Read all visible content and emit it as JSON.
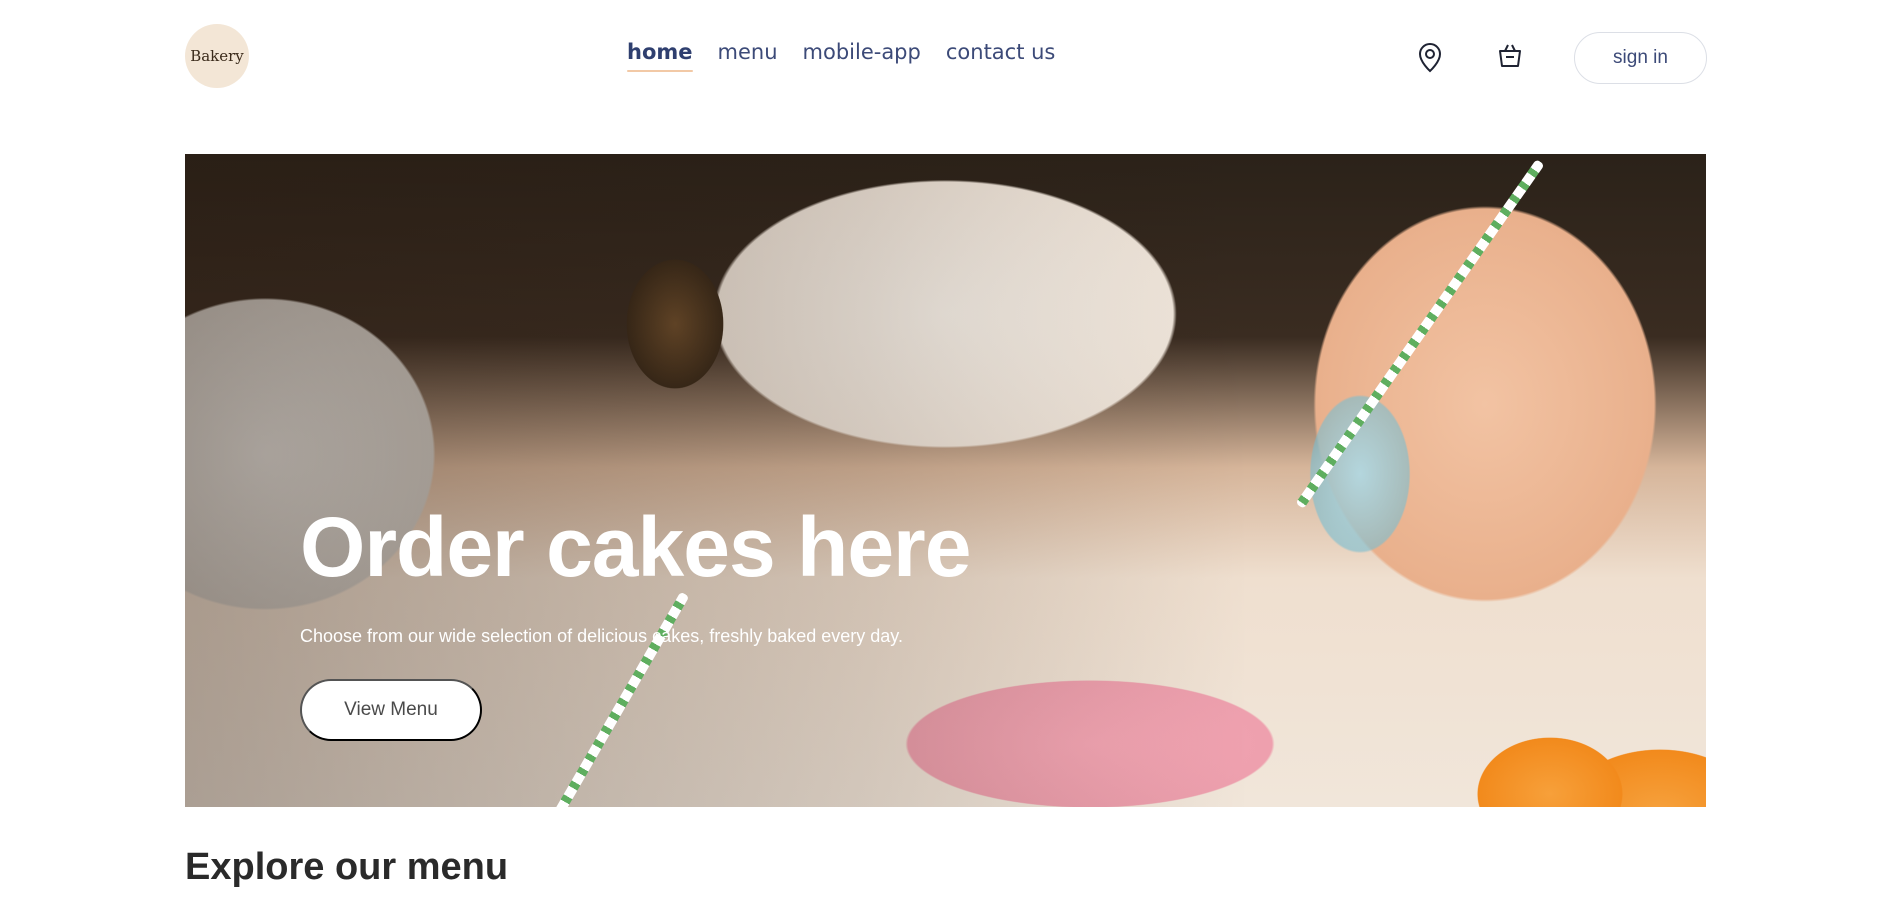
{
  "header": {
    "logo_text": "Bakery",
    "nav": [
      {
        "label": "home",
        "active": true
      },
      {
        "label": "menu",
        "active": false
      },
      {
        "label": "mobile-app",
        "active": false
      },
      {
        "label": "contact us",
        "active": false
      }
    ],
    "icons": [
      "location-pin-icon",
      "basket-icon"
    ],
    "signin_label": "sign in"
  },
  "hero": {
    "title": "Order cakes here",
    "subtitle": "Choose from our wide selection of delicious cakes, freshly baked every day.",
    "button_label": "View Menu"
  },
  "section": {
    "title": "Explore our menu"
  },
  "colors": {
    "nav_text": "#3c4a78",
    "active_underline": "#f2c9a6",
    "logo_bg": "#f3e6d6"
  }
}
